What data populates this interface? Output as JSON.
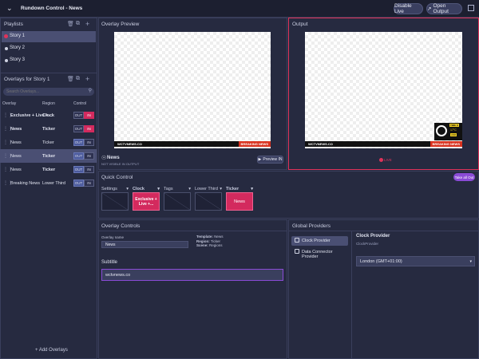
{
  "app": {
    "title": "Rundown Control - News",
    "disable_live": "Disable Live",
    "open_output": "Open Output"
  },
  "playlists": {
    "title": "Playlists",
    "items": [
      {
        "label": "Story 1"
      },
      {
        "label": "Story 2"
      },
      {
        "label": "Story 3"
      }
    ]
  },
  "overlays": {
    "title": "Overlays for Story 1",
    "search_placeholder": "Search Overlays...",
    "columns": {
      "overlay": "Overlay",
      "region": "Region",
      "control": "Control"
    },
    "rows": [
      {
        "name": "Exclusive + Live +...",
        "region": "Clock",
        "out": "OUT",
        "in": "IN"
      },
      {
        "name": "News",
        "region": "Ticker",
        "out": "OUT",
        "in": "IN"
      },
      {
        "name": "News",
        "region": "Ticker",
        "out": "OUT",
        "in": "IN"
      },
      {
        "name": "News",
        "region": "Ticker",
        "out": "OUT",
        "in": "IN"
      },
      {
        "name": "News",
        "region": "Ticker",
        "out": "OUT",
        "in": "IN"
      },
      {
        "name": "Breaking News",
        "region": "Lower Third",
        "out": "OUT",
        "in": "IN"
      }
    ],
    "add_label": "+ Add Overlays"
  },
  "overlay_preview": {
    "title": "Overlay Preview",
    "name": "News",
    "sub": "NOT VISIBLE IN OUTPUT",
    "preview_btn": "Preview IN",
    "site": "WCTVNEWS.CO",
    "breaking": "BREAKING NEWS"
  },
  "output": {
    "title": "Output",
    "live": "LIVE",
    "site": "WCTVNEWS.CO",
    "breaking": "BREAKING NEWS",
    "clock_time": "TIME 8",
    "clock_temp": "17°C",
    "clock_tag": "ANR"
  },
  "quick_control": {
    "title": "Quick Control",
    "take_all_out": "Take all Out",
    "groups": [
      {
        "label": "Settings",
        "item": ""
      },
      {
        "label": "Clock",
        "item": "Exclusive + Live +..."
      },
      {
        "label": "Tags",
        "item": ""
      },
      {
        "label": "Lower Third",
        "item": ""
      },
      {
        "label": "Ticker",
        "item": "News"
      }
    ]
  },
  "overlay_controls": {
    "title": "Overlay Controls",
    "name_label": "Overlay name",
    "name_value": "News",
    "template_label": "Template:",
    "template_value": "News",
    "region_label": "Region:",
    "region_value": "Ticker",
    "scene_label": "Scene:",
    "scene_value": "Regions",
    "subtitle_label": "Subtitle",
    "subtitle_value": "wctvnews.co"
  },
  "global_providers": {
    "title": "Global Providers",
    "items": [
      {
        "label": "Clock Provider"
      },
      {
        "label": "Data Connector Provider"
      }
    ],
    "detail_title": "Clock Provider",
    "detail_sub": "ClockProvider",
    "timezone": "London (GMT+01:00)"
  },
  "colors": {
    "accent": "#d32a5e",
    "purple": "#8a4bd6",
    "bg": "#262a40"
  }
}
